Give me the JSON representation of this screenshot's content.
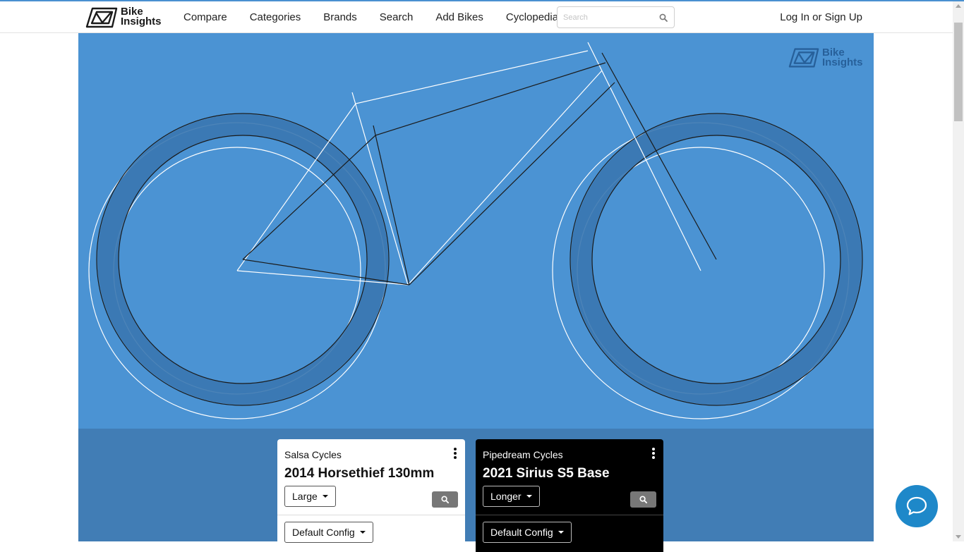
{
  "navbar": {
    "brand_line1": "Bike",
    "brand_line2": "Insights",
    "links": [
      "Compare",
      "Categories",
      "Brands",
      "Search",
      "Add Bikes",
      "Cyclopedia"
    ],
    "search_placeholder": "Search",
    "login_label": "Log In or Sign Up"
  },
  "hero": {
    "watermark_line1": "Bike",
    "watermark_line2": "Insights",
    "background_color": "#4b93d3"
  },
  "comparisons": [
    {
      "brand": "Salsa Cycles",
      "model": "2014 Horsethief 130mm",
      "size": "Large",
      "config": "Default Config",
      "theme": "light"
    },
    {
      "brand": "Pipedream Cycles",
      "model": "2021 Sirius S5 Base",
      "size": "Longer",
      "config": "Default Config",
      "theme": "dark"
    }
  ],
  "icons": {
    "search": "search-icon",
    "kebab": "kebab-menu-icon",
    "chat": "chat-bubble-icon",
    "logo": "bike-insights-logo"
  }
}
